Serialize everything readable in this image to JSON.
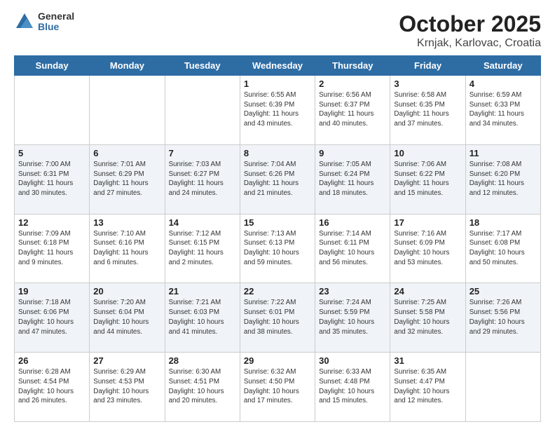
{
  "header": {
    "logo_general": "General",
    "logo_blue": "Blue",
    "title": "October 2025",
    "subtitle": "Krnjak, Karlovac, Croatia"
  },
  "weekdays": [
    "Sunday",
    "Monday",
    "Tuesday",
    "Wednesday",
    "Thursday",
    "Friday",
    "Saturday"
  ],
  "weeks": [
    [
      {
        "day": "",
        "info": ""
      },
      {
        "day": "",
        "info": ""
      },
      {
        "day": "",
        "info": ""
      },
      {
        "day": "1",
        "info": "Sunrise: 6:55 AM\nSunset: 6:39 PM\nDaylight: 11 hours\nand 43 minutes."
      },
      {
        "day": "2",
        "info": "Sunrise: 6:56 AM\nSunset: 6:37 PM\nDaylight: 11 hours\nand 40 minutes."
      },
      {
        "day": "3",
        "info": "Sunrise: 6:58 AM\nSunset: 6:35 PM\nDaylight: 11 hours\nand 37 minutes."
      },
      {
        "day": "4",
        "info": "Sunrise: 6:59 AM\nSunset: 6:33 PM\nDaylight: 11 hours\nand 34 minutes."
      }
    ],
    [
      {
        "day": "5",
        "info": "Sunrise: 7:00 AM\nSunset: 6:31 PM\nDaylight: 11 hours\nand 30 minutes."
      },
      {
        "day": "6",
        "info": "Sunrise: 7:01 AM\nSunset: 6:29 PM\nDaylight: 11 hours\nand 27 minutes."
      },
      {
        "day": "7",
        "info": "Sunrise: 7:03 AM\nSunset: 6:27 PM\nDaylight: 11 hours\nand 24 minutes."
      },
      {
        "day": "8",
        "info": "Sunrise: 7:04 AM\nSunset: 6:26 PM\nDaylight: 11 hours\nand 21 minutes."
      },
      {
        "day": "9",
        "info": "Sunrise: 7:05 AM\nSunset: 6:24 PM\nDaylight: 11 hours\nand 18 minutes."
      },
      {
        "day": "10",
        "info": "Sunrise: 7:06 AM\nSunset: 6:22 PM\nDaylight: 11 hours\nand 15 minutes."
      },
      {
        "day": "11",
        "info": "Sunrise: 7:08 AM\nSunset: 6:20 PM\nDaylight: 11 hours\nand 12 minutes."
      }
    ],
    [
      {
        "day": "12",
        "info": "Sunrise: 7:09 AM\nSunset: 6:18 PM\nDaylight: 11 hours\nand 9 minutes."
      },
      {
        "day": "13",
        "info": "Sunrise: 7:10 AM\nSunset: 6:16 PM\nDaylight: 11 hours\nand 6 minutes."
      },
      {
        "day": "14",
        "info": "Sunrise: 7:12 AM\nSunset: 6:15 PM\nDaylight: 11 hours\nand 2 minutes."
      },
      {
        "day": "15",
        "info": "Sunrise: 7:13 AM\nSunset: 6:13 PM\nDaylight: 10 hours\nand 59 minutes."
      },
      {
        "day": "16",
        "info": "Sunrise: 7:14 AM\nSunset: 6:11 PM\nDaylight: 10 hours\nand 56 minutes."
      },
      {
        "day": "17",
        "info": "Sunrise: 7:16 AM\nSunset: 6:09 PM\nDaylight: 10 hours\nand 53 minutes."
      },
      {
        "day": "18",
        "info": "Sunrise: 7:17 AM\nSunset: 6:08 PM\nDaylight: 10 hours\nand 50 minutes."
      }
    ],
    [
      {
        "day": "19",
        "info": "Sunrise: 7:18 AM\nSunset: 6:06 PM\nDaylight: 10 hours\nand 47 minutes."
      },
      {
        "day": "20",
        "info": "Sunrise: 7:20 AM\nSunset: 6:04 PM\nDaylight: 10 hours\nand 44 minutes."
      },
      {
        "day": "21",
        "info": "Sunrise: 7:21 AM\nSunset: 6:03 PM\nDaylight: 10 hours\nand 41 minutes."
      },
      {
        "day": "22",
        "info": "Sunrise: 7:22 AM\nSunset: 6:01 PM\nDaylight: 10 hours\nand 38 minutes."
      },
      {
        "day": "23",
        "info": "Sunrise: 7:24 AM\nSunset: 5:59 PM\nDaylight: 10 hours\nand 35 minutes."
      },
      {
        "day": "24",
        "info": "Sunrise: 7:25 AM\nSunset: 5:58 PM\nDaylight: 10 hours\nand 32 minutes."
      },
      {
        "day": "25",
        "info": "Sunrise: 7:26 AM\nSunset: 5:56 PM\nDaylight: 10 hours\nand 29 minutes."
      }
    ],
    [
      {
        "day": "26",
        "info": "Sunrise: 6:28 AM\nSunset: 4:54 PM\nDaylight: 10 hours\nand 26 minutes."
      },
      {
        "day": "27",
        "info": "Sunrise: 6:29 AM\nSunset: 4:53 PM\nDaylight: 10 hours\nand 23 minutes."
      },
      {
        "day": "28",
        "info": "Sunrise: 6:30 AM\nSunset: 4:51 PM\nDaylight: 10 hours\nand 20 minutes."
      },
      {
        "day": "29",
        "info": "Sunrise: 6:32 AM\nSunset: 4:50 PM\nDaylight: 10 hours\nand 17 minutes."
      },
      {
        "day": "30",
        "info": "Sunrise: 6:33 AM\nSunset: 4:48 PM\nDaylight: 10 hours\nand 15 minutes."
      },
      {
        "day": "31",
        "info": "Sunrise: 6:35 AM\nSunset: 4:47 PM\nDaylight: 10 hours\nand 12 minutes."
      },
      {
        "day": "",
        "info": ""
      }
    ]
  ]
}
